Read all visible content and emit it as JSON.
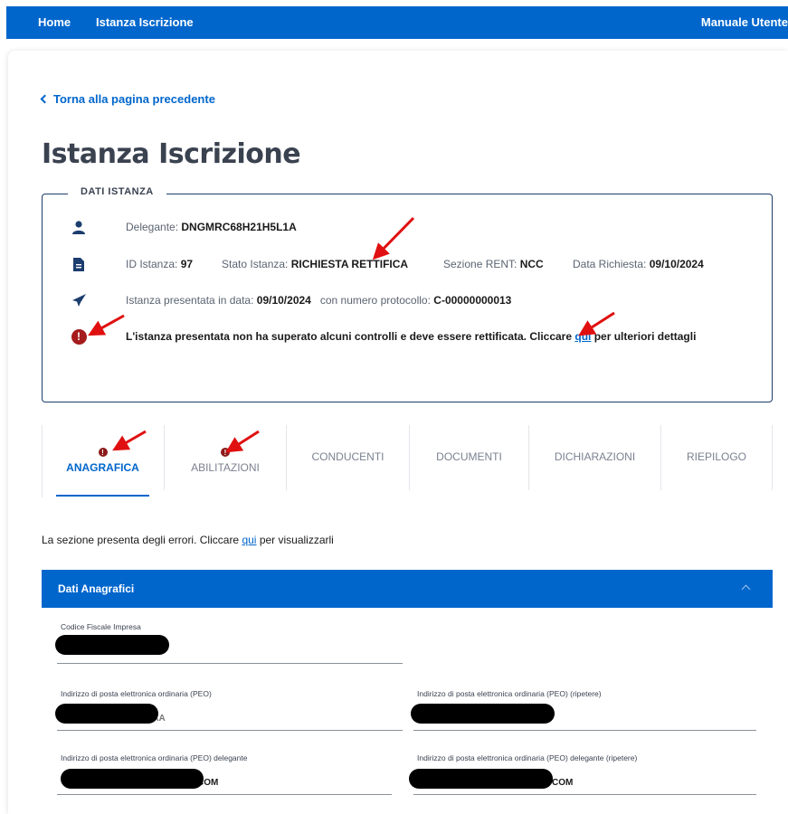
{
  "topbar": {
    "home": "Home",
    "istanza": "Istanza Iscrizione",
    "manuale": "Manuale Utente"
  },
  "back_link": "Torna alla pagina precedente",
  "page_title": "Istanza Iscrizione",
  "dati_istanza": {
    "legend": "DATI ISTANZA",
    "delegante_label": "Delegante:",
    "delegante_value": "DNGMRC68H21H5L1A",
    "id_label": "ID Istanza:",
    "id_value": "97",
    "stato_label": "Stato Istanza:",
    "stato_value": "RICHIESTA RETTIFICA",
    "sezione_label": "Sezione RENT:",
    "sezione_value": "NCC",
    "data_label": "Data Richiesta:",
    "data_value": "09/10/2024",
    "presentata_label": "Istanza presentata in data:",
    "presentata_value": "09/10/2024",
    "protocollo_label": "con numero protocollo:",
    "protocollo_value": "C-00000000013",
    "warning_text": "L'istanza presentata non ha superato alcuni controlli e deve essere rettificata. Cliccare",
    "warning_link": "qui",
    "warning_after": "per ulteriori dettagli",
    "error_glyph": "!"
  },
  "tabs": [
    {
      "label": "ANAGRAFICA",
      "error": true,
      "active": true
    },
    {
      "label": "ABILITAZIONI",
      "error": true,
      "active": false
    },
    {
      "label": "CONDUCENTI",
      "error": false,
      "active": false
    },
    {
      "label": "DOCUMENTI",
      "error": false,
      "active": false
    },
    {
      "label": "DICHIARAZIONI",
      "error": false,
      "active": false
    },
    {
      "label": "RIEPILOGO",
      "error": false,
      "active": false
    }
  ],
  "section_message": {
    "before": "La sezione presenta degli errori. Cliccare",
    "link": "qui",
    "after": "per visualizzarli"
  },
  "accordion": {
    "title": "Dati Anagrafici"
  },
  "fields": {
    "codice_fiscale_label": "Codice Fiscale Impresa",
    "peo_label": "Indirizzo di posta elettronica ordinaria (PEO)",
    "peo_value_tail": "AAA",
    "peo_repeat_label": "Indirizzo di posta elettronica ordinaria (PEO) (ripetere)",
    "peo_delegante_label": "Indirizzo di posta elettronica ordinaria (PEO) delegante",
    "peo_delegante_value_tail": "COM",
    "peo_delegante_repeat_label": "Indirizzo di posta elettronica ordinaria (PEO) delegante (ripetere)",
    "peo_delegante_repeat_value_tail": "COM"
  },
  "icons": {
    "user": "user-icon",
    "document": "document-icon",
    "send": "paper-plane-icon",
    "error": "exclamation-circle-icon"
  },
  "colors": {
    "primary": "#0066cc",
    "dark_blue": "#1c3d6e",
    "error_red": "#a61c1c",
    "annotation_arrow": "#e01010"
  }
}
